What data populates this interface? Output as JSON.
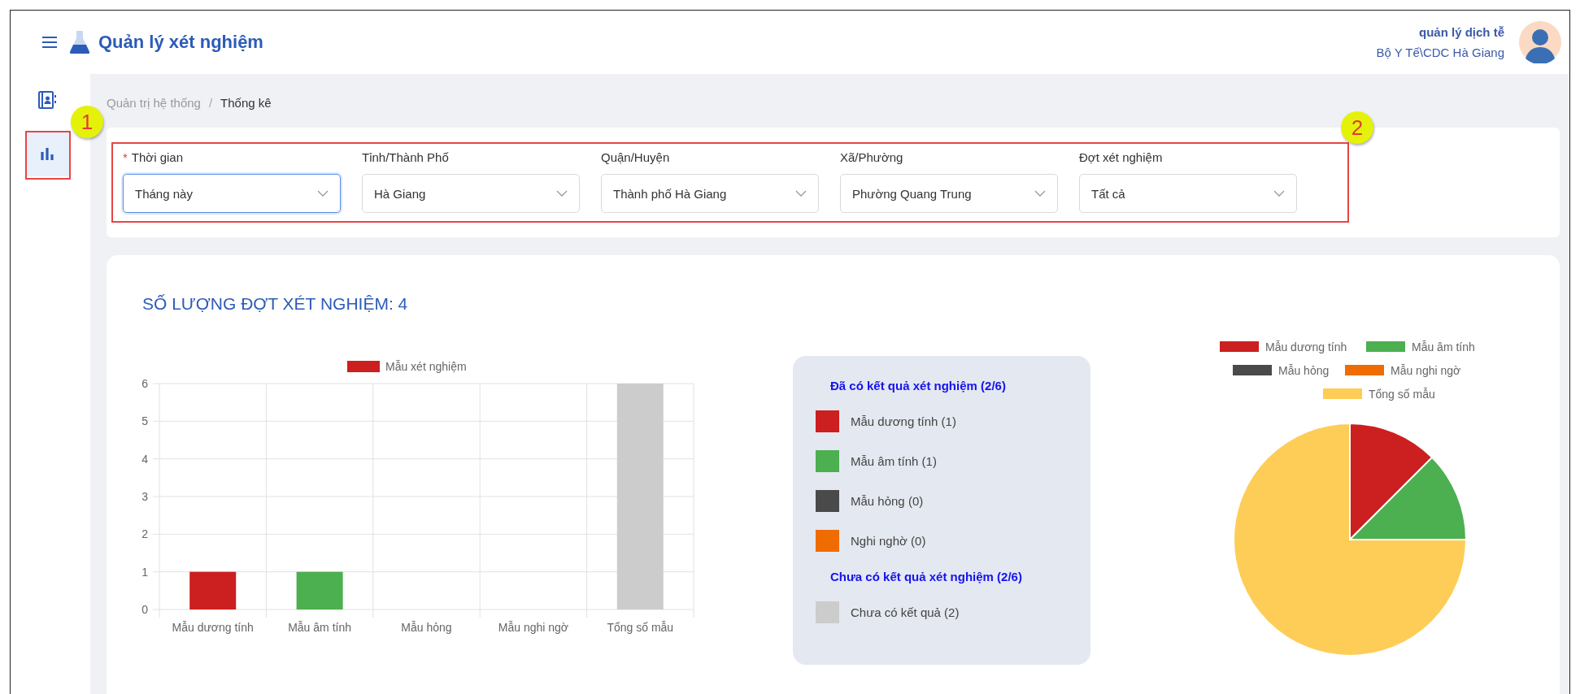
{
  "app": {
    "title": "Quản lý xét nghiệm"
  },
  "user": {
    "name": "quản lý dịch tễ",
    "unit": "Bộ Y Tế\\CDC Hà Giang"
  },
  "sidebar": {
    "items": [
      {
        "kind": "contacts",
        "selected": false
      },
      {
        "kind": "chart",
        "selected": true
      }
    ]
  },
  "breadcrumb": {
    "items": [
      "Quản trị hệ thống",
      "Thống kê"
    ],
    "separator": "/"
  },
  "required_marker": "*",
  "filters": [
    {
      "label": "Thời gian",
      "required": true,
      "value": "Tháng này",
      "focused": true
    },
    {
      "label": "Tỉnh/Thành Phố",
      "required": false,
      "value": "Hà Giang",
      "focused": false
    },
    {
      "label": "Quận/Huyện",
      "required": false,
      "value": "Thành phố Hà Giang",
      "focused": false
    },
    {
      "label": "Xã/Phường",
      "required": false,
      "value": "Phường Quang Trung",
      "focused": false
    },
    {
      "label": "Đợt xét nghiệm",
      "required": false,
      "value": "Tất cả",
      "focused": false
    }
  ],
  "annotations": [
    {
      "label": "1"
    },
    {
      "label": "2"
    }
  ],
  "stats": {
    "title": "SỐ LƯỢNG ĐỢT XÉT NGHIỆM: 4",
    "bar_chart": {
      "chart_data": {
        "type": "bar",
        "categories": [
          "Mẫu dương tính",
          "Mẫu âm tính",
          "Mẫu hỏng",
          "Mẫu nghi ngờ",
          "Tổng số mẫu"
        ],
        "series": [
          {
            "name": "Mẫu xét nghiệm",
            "color": "#cc1f1f",
            "colors": [
              "#cc1f1f",
              "#4caf50",
              null,
              null,
              "#cccccc"
            ],
            "values": [
              1,
              1,
              0,
              0,
              6
            ]
          }
        ],
        "ylim": [
          0,
          6
        ],
        "yticks": [
          0,
          1,
          2,
          3,
          4,
          5,
          6
        ],
        "grid": true,
        "legend": true
      }
    },
    "summary": {
      "groups": [
        {
          "heading": "Đã có kết quả xét nghiệm (2/6)",
          "items": [
            {
              "label": "Mẫu dương tính (1)",
              "color": "#cc1f1f"
            },
            {
              "label": "Mẫu âm tính (1)",
              "color": "#4caf50"
            },
            {
              "label": "Mẫu hỏng (0)",
              "color": "#4a4a4a"
            },
            {
              "label": "Nghi nghờ (0)",
              "color": "#ef6c00"
            }
          ]
        },
        {
          "heading": "Chưa có kết quả xét nghiệm (2/6)",
          "items": [
            {
              "label": "Chưa có kết quả (2)",
              "color": "#cccccc"
            }
          ]
        }
      ]
    },
    "pie_chart": {
      "chart_data": {
        "type": "pie",
        "categories": [
          "Mẫu dương tính",
          "Mẫu âm tính",
          "Mẫu hỏng",
          "Mẫu nghi ngờ",
          "Tổng số mẫu"
        ],
        "values": [
          12.5,
          12.5,
          0,
          0,
          75
        ],
        "colors": [
          "#cc1f1f",
          "#4caf50",
          "#4a4a4a",
          "#ef6c00",
          "#fecd57"
        ],
        "legend": true
      }
    }
  }
}
